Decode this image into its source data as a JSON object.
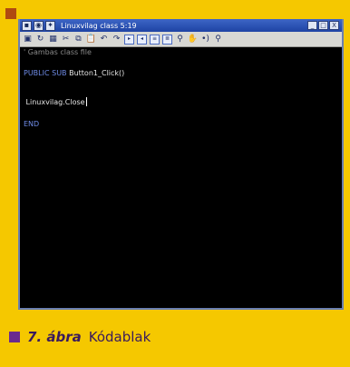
{
  "window": {
    "title": "Linuxvilag class 5:19",
    "title_buttons": [
      "▪",
      "◉",
      "✦"
    ],
    "controls": [
      "_",
      "□",
      "X"
    ]
  },
  "toolbar": {
    "icons": [
      "save-icon",
      "refresh-icon",
      "grid-icon",
      "cut-icon",
      "copy-icon",
      "paste-icon",
      "undo-icon",
      "redo-icon",
      "indent-icon",
      "unindent-icon",
      "comment-icon",
      "uncomment-icon",
      "binoculars-icon",
      "hand-icon",
      "breakpoint-icon",
      "magnifier-icon"
    ]
  },
  "editor": {
    "comment": "' Gambas class file",
    "sub_decl_kw": "PUBLIC SUB",
    "sub_decl_name": " Button1_Click()",
    "body": " Linuxvilag.Close",
    "end_kw": "END"
  },
  "caption": {
    "number": "7. ábra",
    "text": "Kódablak"
  },
  "colors": {
    "page_bg": "#f5c800",
    "editor_bg": "#000000",
    "keyword": "#6f8ce8",
    "caption_square": "#6a2a8e"
  }
}
